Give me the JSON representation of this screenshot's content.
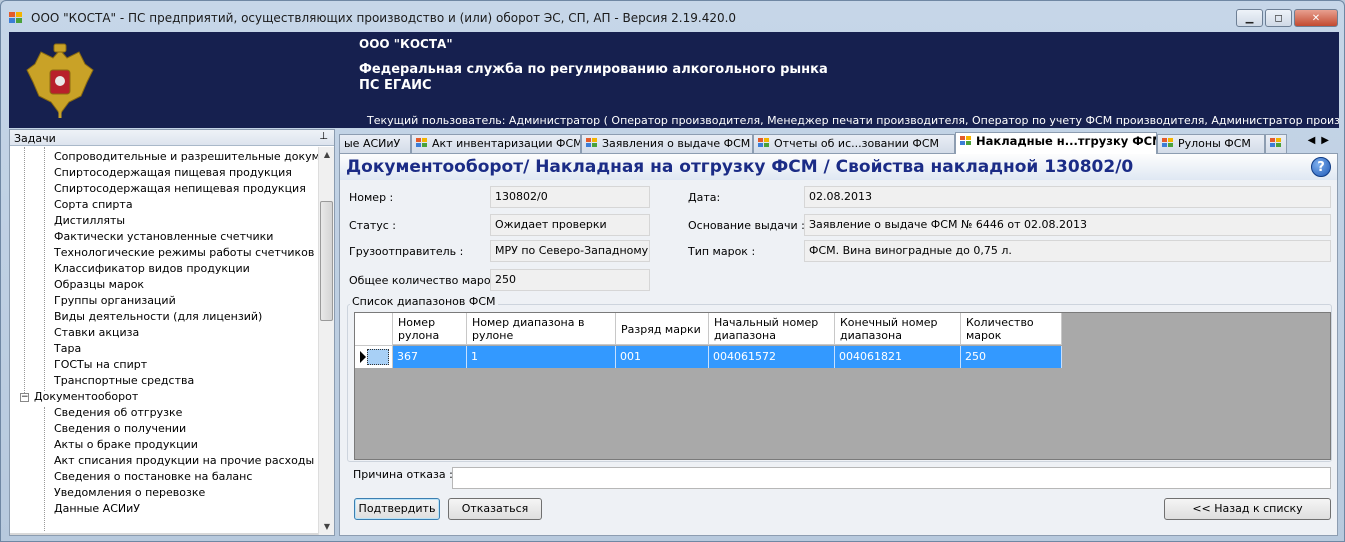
{
  "window": {
    "title": "ООО \"КОСТА\" - ПС предприятий, осуществляющих производство и (или) оборот ЭС, СП, АП - Версия 2.19.420.0",
    "minimize": "▁",
    "maximize": "◻",
    "close": "✕"
  },
  "banner": {
    "org": "ООО \"КОСТА\"",
    "federal_service": "Федеральная служба по регулированию алкогольного рынка",
    "system": "ПС ЕГАИС",
    "current_user": "Текущий пользователь: Администратор ( Оператор производителя, Менеджер печати производителя, Оператор по учету ФСМ производителя, Администратор производителя, Оператор п..."
  },
  "left_panel": {
    "title": "Задачи",
    "pin": "ᵖ",
    "items": [
      "Сопроводительные и разрешительные документы",
      "Спиртосодержащая пищевая продукция",
      "Спиртосодержащая непищевая продукция",
      "Сорта спирта",
      "Дистилляты",
      "Фактически установленные счетчики",
      "Технологические режимы работы счетчиков",
      "Классификатор видов продукции",
      "Образцы марок",
      "Группы организаций",
      "Виды деятельности (для лицензий)",
      "Ставки акциза",
      "Тара",
      "ГОСТы на спирт",
      "Транспортные средства"
    ],
    "group": "Документооборот",
    "group_expander": "−",
    "group_items": [
      "Сведения об отгрузке",
      "Сведения о получении",
      "Акты о браке продукции",
      "Акт списания продукции на прочие расходы",
      "Сведения о постановке на баланс",
      "Уведомления о перевозке",
      "Данные АСИиУ"
    ]
  },
  "tabs": [
    {
      "label": "ые АСИиУ",
      "icon": false
    },
    {
      "label": "Акт инвентаризации ФСМ",
      "icon": true
    },
    {
      "label": "Заявления о выдаче ФСМ",
      "icon": true
    },
    {
      "label": "Отчеты об ис...зовании ФСМ",
      "icon": true
    },
    {
      "label": "Накладные  н...тгрузку ФСМ",
      "icon": true,
      "active": true
    },
    {
      "label": "Рулоны ФСМ",
      "icon": true
    },
    {
      "label": "",
      "icon": true
    }
  ],
  "tab_nav": "◀▶",
  "document": {
    "title": "Документооборот/ Накладная на отгрузку ФСМ / Свойства накладной 130802/0",
    "help": "?",
    "fields": {
      "number_label": "Номер :",
      "number": "130802/0",
      "date_label": "Дата:",
      "date": "02.08.2013",
      "status_label": "Статус :",
      "status": "Ожидает проверки",
      "basis_label": "Основание выдачи :",
      "basis": "Заявление о выдаче ФСМ № 6446 от 02.08.2013",
      "shipper_label": "Грузоотправитель :",
      "shipper": "МРУ по Северо-Западному ФС",
      "mark_type_label": "Тип марок :",
      "mark_type": "ФСМ. Вина виноградные до 0,75 л.",
      "total_label": "Общее количество марок :",
      "total": "250"
    },
    "ranges": {
      "group_label": "Список диапазонов ФСМ",
      "columns": [
        "Номер\nрулона",
        "Номер диапазона в\nрулоне",
        "Разряд марки",
        "Начальный номер\nдиапазона",
        "Конечный номер\nдиапазона",
        "Количество\nмарок"
      ],
      "rows": [
        [
          "367",
          "1",
          "001",
          "004061572",
          "004061821",
          "250"
        ]
      ]
    },
    "reason_label": "Причина отказа :",
    "reason_value": "",
    "confirm": "Подтвердить",
    "reject": "Отказаться",
    "back": "<< Назад к списку"
  },
  "colors": {
    "banner": "#16204f",
    "selection": "#3399ff",
    "title": "#1b2c86"
  }
}
